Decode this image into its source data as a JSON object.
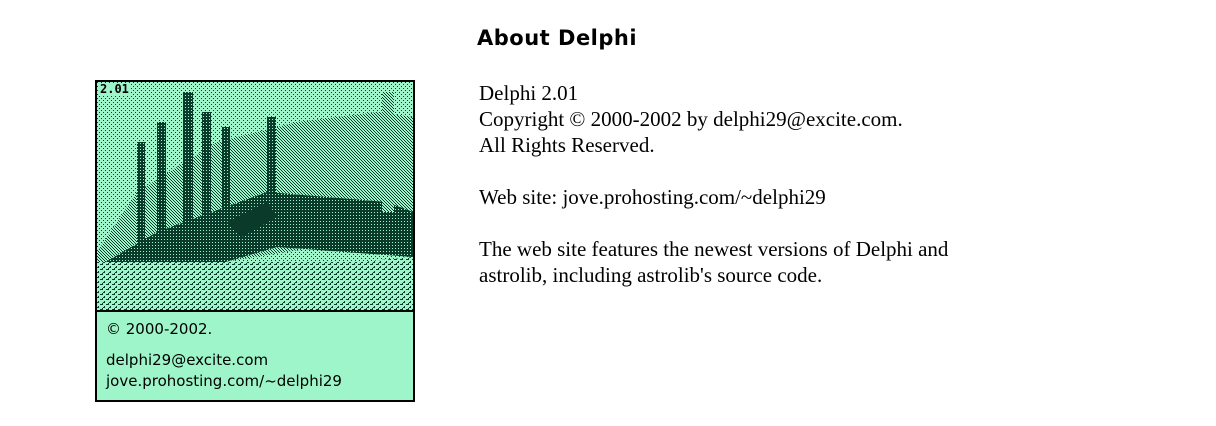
{
  "window": {
    "title": "About Delphi"
  },
  "splash": {
    "version_label": "2.01",
    "copyright_line": "© 2000-2002.",
    "email_line": "delphi29@excite.com",
    "web_line": "jove.prohosting.com/~delphi29",
    "image_subject": "dithered photo of temple ruins with columns"
  },
  "info": {
    "line1": "Delphi 2.01",
    "line2": "Copyright © 2000-2002 by delphi29@excite.com.",
    "line3": "All Rights Reserved.",
    "website_line": "Web site: jove.prohosting.com/~delphi29",
    "features_line1": "The web site features the newest versions of Delphi and",
    "features_line2": "astrolib, including astrolib's source code."
  },
  "colors": {
    "splash_background": "#9ef5c9",
    "splash_ink": "#0a3a2a",
    "border": "#000000",
    "text": "#000000"
  }
}
